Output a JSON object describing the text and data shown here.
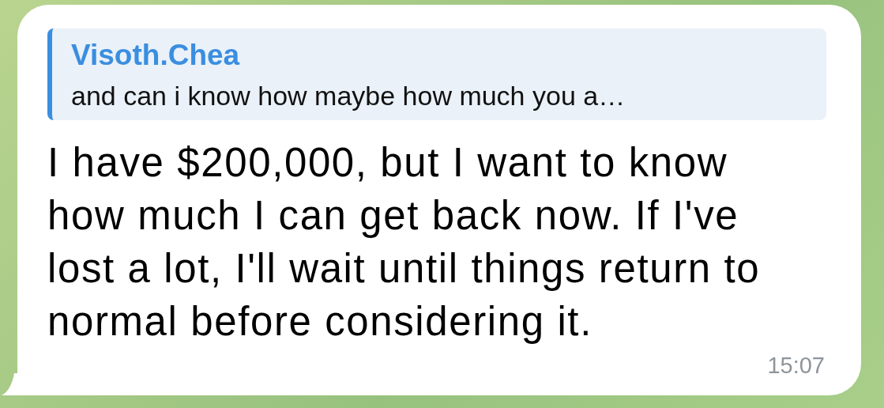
{
  "message": {
    "reply": {
      "author": "Visoth.Chea",
      "text": "and can i know how maybe how much you a…"
    },
    "text": "I have $200,000, but I want to know how much I can get back now. If I've lost a lot, I'll wait until things return to normal before considering it.",
    "time": "15:07"
  }
}
